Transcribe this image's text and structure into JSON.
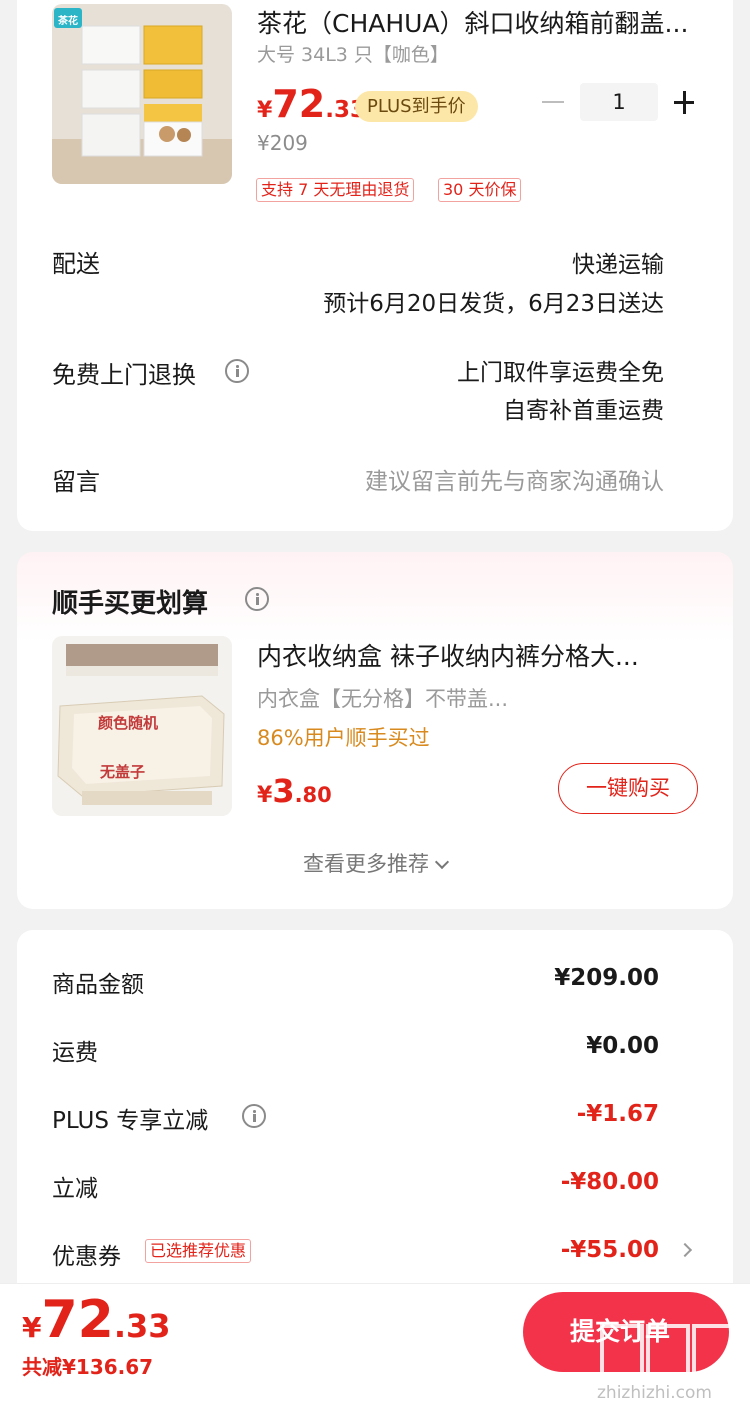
{
  "product": {
    "brand_logo": "茶花",
    "title": "茶花（CHAHUA）斜口收纳箱前翻盖...",
    "spec": "大号 34L3 只【咖色】",
    "price_yen": "¥",
    "price_int": "72",
    "price_dec": ".33",
    "plus_badge": "PLUS到手价",
    "original_price": "¥209",
    "tags": [
      "支持 7 天无理由退货",
      "30 天价保"
    ],
    "quantity": "1"
  },
  "delivery": {
    "label": "配送",
    "method": "快递运输",
    "estimate": "预计6月20日发货，6月23日送达"
  },
  "returns": {
    "label": "免费上门退换",
    "line1": "上门取件享运费全免",
    "line2": "自寄补首重运费"
  },
  "message": {
    "label": "留言",
    "placeholder": "建议留言前先与商家沟通确认"
  },
  "recommend": {
    "section_title": "顺手买更划算",
    "item_title": "内衣收纳盒 袜子收纳内裤分格大...",
    "item_spec": "内衣盒【无分格】不带盖...",
    "bought_ratio": "86%用户顺手买过",
    "price_yen": "¥",
    "price_int": "3",
    "price_dec": ".80",
    "image_text_1": "颜色随机",
    "image_text_2": "无盖子",
    "buy_button": "一键购买",
    "more": "查看更多推荐"
  },
  "summary": {
    "goods_label": "商品金额",
    "goods_value": "¥209.00",
    "shipping_label": "运费",
    "shipping_value": "¥0.00",
    "plus_discount_label": "PLUS 专享立减",
    "plus_discount_value": "-¥1.67",
    "instant_discount_label": "立减",
    "instant_discount_value": "-¥80.00",
    "coupon_label": "优惠券",
    "coupon_tag": "已选推荐优惠",
    "coupon_value": "-¥55.00"
  },
  "footer": {
    "total_yen": "¥",
    "total_int": "72",
    "total_dec": ".33",
    "saved": "共减¥136.67",
    "submit": "提交订单"
  },
  "watermark": {
    "site": "zhizhizhi.com",
    "logo_text": "值值值"
  },
  "colors": {
    "accent_red": "#e2231a",
    "submit_red": "#f2334a",
    "plus_gold": "#fde7a8"
  }
}
